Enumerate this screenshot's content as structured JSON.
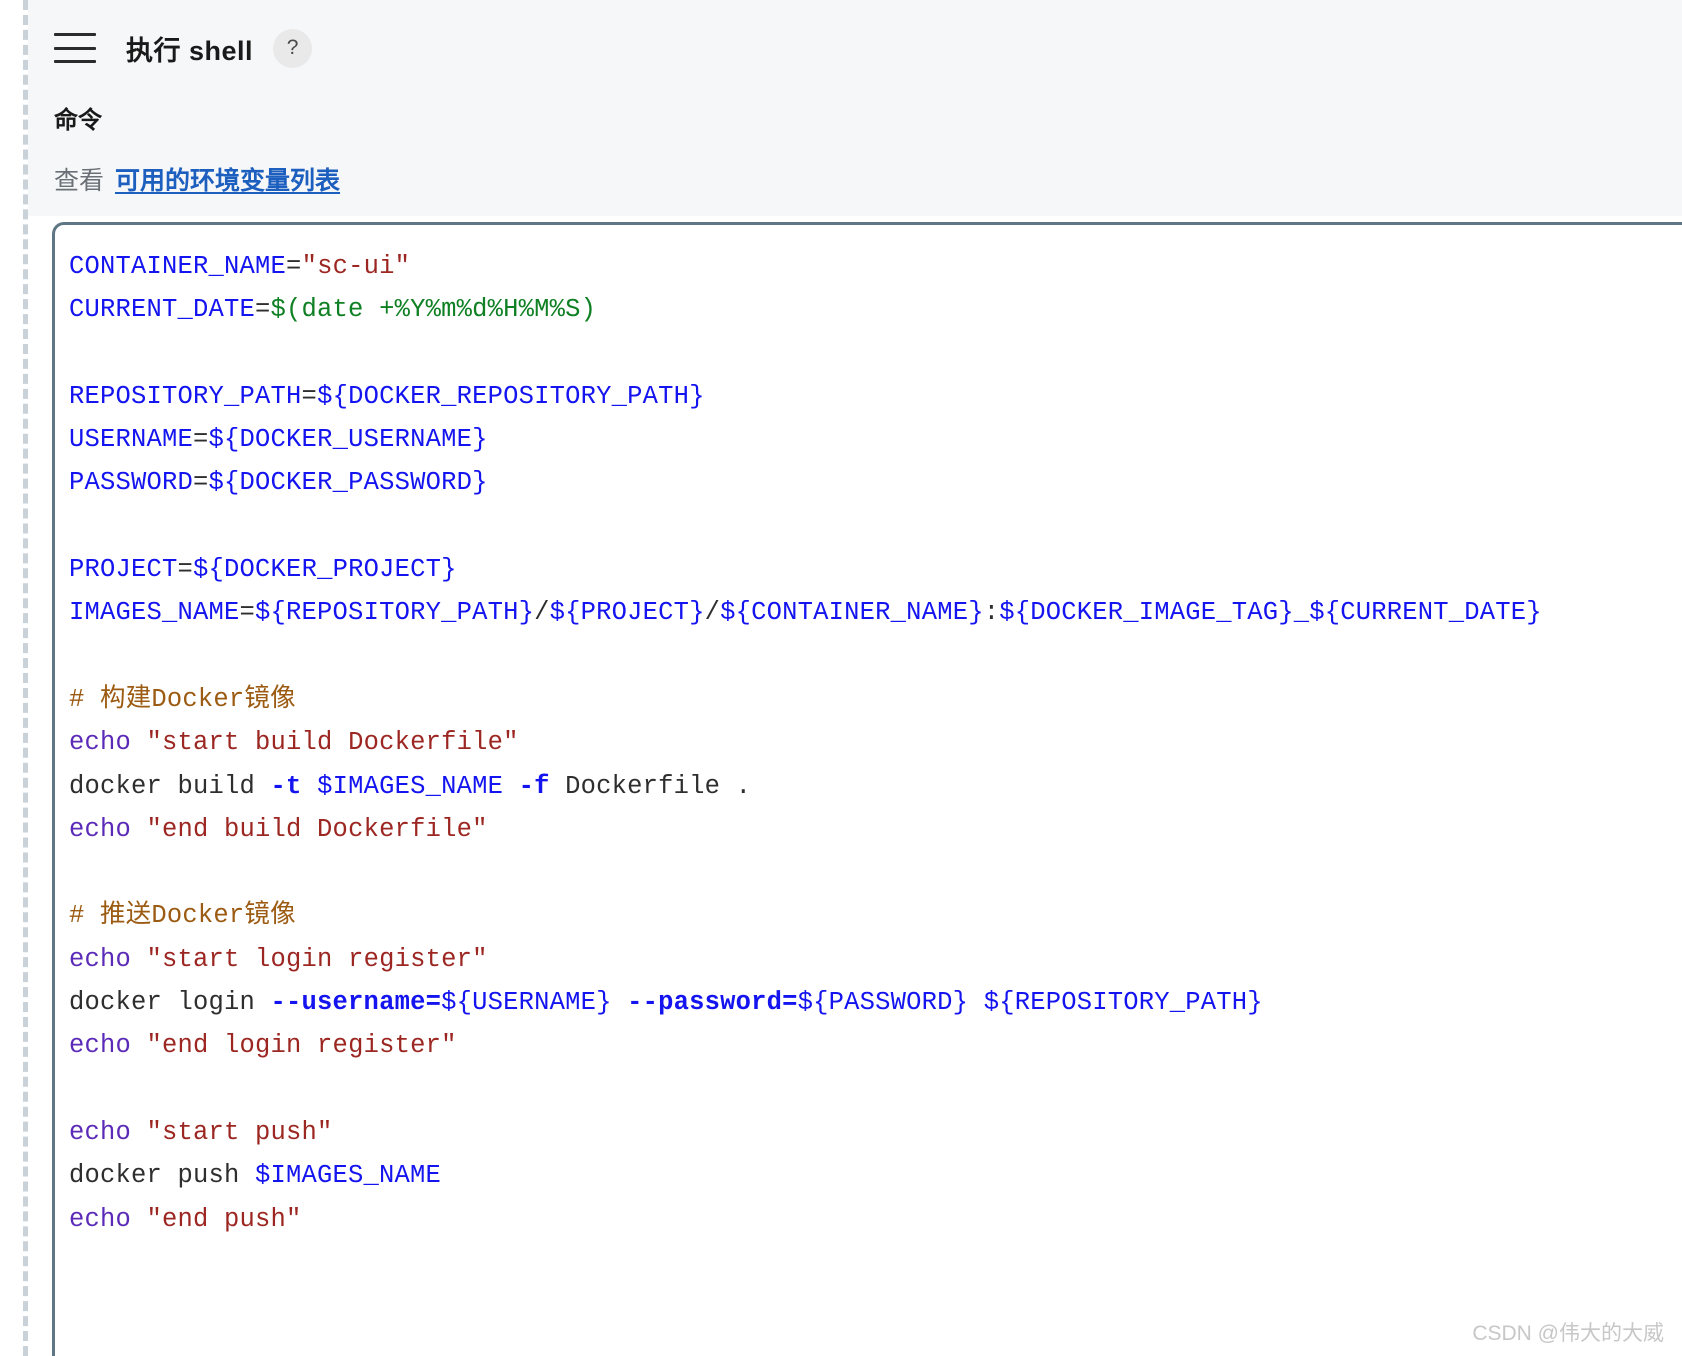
{
  "header": {
    "menu_icon": "hamburger-icon",
    "title": "执行 shell",
    "help_label": "?",
    "field_label": "命令",
    "hint_prefix": "查看",
    "hint_link": "可用的环境变量列表"
  },
  "colors": {
    "page_bg": "#ffffff",
    "header_bg": "#f6f7f8",
    "dashed_rail": "#c9d1d9",
    "code_border": "#5f7785",
    "link": "#1d5fbf",
    "token_variable": "#1414f0",
    "token_string": "#9c2722",
    "token_substitution": "#0f8024",
    "token_comment": "#9c5b12",
    "token_builtin": "#5b2bb8",
    "token_plain": "#2e2e2e",
    "watermark": "#c7c7c7"
  },
  "code": {
    "language": "shell",
    "lines": [
      [
        {
          "t": "CONTAINER_NAME",
          "c": "tok-var"
        },
        {
          "t": "=",
          "c": "tok-op"
        },
        {
          "t": "\"sc-ui\"",
          "c": "tok-str"
        }
      ],
      [
        {
          "t": "CURRENT_DATE",
          "c": "tok-var"
        },
        {
          "t": "=",
          "c": "tok-op"
        },
        {
          "t": "$(date +%Y%m%d%H%M%S)",
          "c": "tok-subst"
        }
      ],
      [],
      [
        {
          "t": "REPOSITORY_PATH",
          "c": "tok-var"
        },
        {
          "t": "=",
          "c": "tok-op"
        },
        {
          "t": "${DOCKER_REPOSITORY_PATH}",
          "c": "tok-var"
        }
      ],
      [
        {
          "t": "USERNAME",
          "c": "tok-var"
        },
        {
          "t": "=",
          "c": "tok-op"
        },
        {
          "t": "${DOCKER_USERNAME}",
          "c": "tok-var"
        }
      ],
      [
        {
          "t": "PASSWORD",
          "c": "tok-var"
        },
        {
          "t": "=",
          "c": "tok-op"
        },
        {
          "t": "${DOCKER_PASSWORD}",
          "c": "tok-var"
        }
      ],
      [],
      [
        {
          "t": "PROJECT",
          "c": "tok-var"
        },
        {
          "t": "=",
          "c": "tok-op"
        },
        {
          "t": "${DOCKER_PROJECT}",
          "c": "tok-var"
        }
      ],
      [
        {
          "t": "IMAGES_NAME",
          "c": "tok-var"
        },
        {
          "t": "=",
          "c": "tok-op"
        },
        {
          "t": "${REPOSITORY_PATH}",
          "c": "tok-var"
        },
        {
          "t": "/",
          "c": "tok-op"
        },
        {
          "t": "${PROJECT}",
          "c": "tok-var"
        },
        {
          "t": "/",
          "c": "tok-op"
        },
        {
          "t": "${CONTAINER_NAME}",
          "c": "tok-var"
        },
        {
          "t": ":",
          "c": "tok-op"
        },
        {
          "t": "${DOCKER_IMAGE_TAG}_${CURRENT_DATE}",
          "c": "tok-var"
        }
      ],
      [],
      [
        {
          "t": "# 构建Docker镜像",
          "c": "tok-comment"
        }
      ],
      [
        {
          "t": "echo",
          "c": "tok-builtin"
        },
        {
          "t": " ",
          "c": "tok-plain"
        },
        {
          "t": "\"start build Dockerfile\"",
          "c": "tok-str"
        }
      ],
      [
        {
          "t": "docker build ",
          "c": "tok-plain"
        },
        {
          "t": "-t",
          "c": "tok-flag"
        },
        {
          "t": " ",
          "c": "tok-plain"
        },
        {
          "t": "$IMAGES_NAME",
          "c": "tok-var"
        },
        {
          "t": " ",
          "c": "tok-plain"
        },
        {
          "t": "-f",
          "c": "tok-flag"
        },
        {
          "t": " Dockerfile .",
          "c": "tok-plain"
        }
      ],
      [
        {
          "t": "echo",
          "c": "tok-builtin"
        },
        {
          "t": " ",
          "c": "tok-plain"
        },
        {
          "t": "\"end build Dockerfile\"",
          "c": "tok-str"
        }
      ],
      [],
      [
        {
          "t": "# 推送Docker镜像",
          "c": "tok-comment"
        }
      ],
      [
        {
          "t": "echo",
          "c": "tok-builtin"
        },
        {
          "t": " ",
          "c": "tok-plain"
        },
        {
          "t": "\"start login register\"",
          "c": "tok-str"
        }
      ],
      [
        {
          "t": "docker login ",
          "c": "tok-plain"
        },
        {
          "t": "--username=",
          "c": "tok-flag"
        },
        {
          "t": "${USERNAME}",
          "c": "tok-var"
        },
        {
          "t": " ",
          "c": "tok-plain"
        },
        {
          "t": "--password=",
          "c": "tok-flag"
        },
        {
          "t": "${PASSWORD}",
          "c": "tok-var"
        },
        {
          "t": " ",
          "c": "tok-plain"
        },
        {
          "t": "${REPOSITORY_PATH}",
          "c": "tok-var"
        }
      ],
      [
        {
          "t": "echo",
          "c": "tok-builtin"
        },
        {
          "t": " ",
          "c": "tok-plain"
        },
        {
          "t": "\"end login register\"",
          "c": "tok-str"
        }
      ],
      [],
      [
        {
          "t": "echo",
          "c": "tok-builtin"
        },
        {
          "t": " ",
          "c": "tok-plain"
        },
        {
          "t": "\"start push\"",
          "c": "tok-str"
        }
      ],
      [
        {
          "t": "docker push ",
          "c": "tok-plain"
        },
        {
          "t": "$IMAGES_NAME",
          "c": "tok-var"
        }
      ],
      [
        {
          "t": "echo",
          "c": "tok-builtin"
        },
        {
          "t": " ",
          "c": "tok-plain"
        },
        {
          "t": "\"end push\"",
          "c": "tok-str"
        }
      ]
    ]
  },
  "watermark": "CSDN @伟大的大威"
}
